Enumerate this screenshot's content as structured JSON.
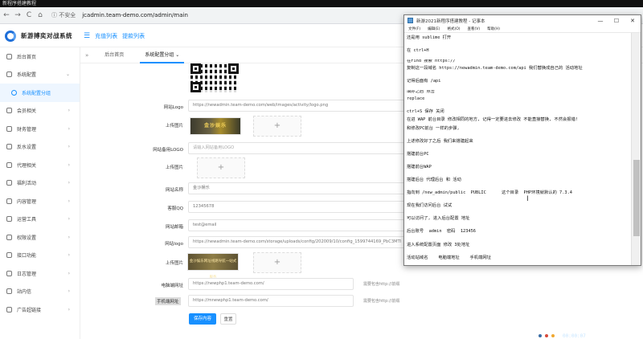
{
  "video": {
    "title": "新程序搭建教程"
  },
  "browser": {
    "back": "←",
    "forward": "→",
    "reload": "C",
    "home": "⌂",
    "insecure": "ⓘ 不安全",
    "url": "jcadmin.team-demo.com/admin/main"
  },
  "app": {
    "name": "新游搏奕对战系统",
    "header_links": [
      "充值列表",
      "提款列表"
    ]
  },
  "sidebar": {
    "items": [
      {
        "label": "后台首页",
        "arrow": ""
      },
      {
        "label": "系统配置",
        "arrow": "⌄"
      },
      {
        "label": "系统配置分组",
        "arrow": "",
        "sub": true
      },
      {
        "label": "会员相关",
        "arrow": "›"
      },
      {
        "label": "财务管理",
        "arrow": "›"
      },
      {
        "label": "反水设置",
        "arrow": "›"
      },
      {
        "label": "代理相关",
        "arrow": "›"
      },
      {
        "label": "福利活动",
        "arrow": "›"
      },
      {
        "label": "内容管理",
        "arrow": "›"
      },
      {
        "label": "运营工具",
        "arrow": "›"
      },
      {
        "label": "权限设置",
        "arrow": "›"
      },
      {
        "label": "接口功能",
        "arrow": "›"
      },
      {
        "label": "日志管理",
        "arrow": "›"
      },
      {
        "label": "站内信",
        "arrow": "›"
      },
      {
        "label": "广告超链接",
        "arrow": "›"
      }
    ]
  },
  "tabs": {
    "toggle": "»",
    "items": [
      "后台首页",
      "系统配置分组"
    ],
    "active_arrow": "⌄"
  },
  "form": {
    "site_logo": {
      "label": "网站Logo",
      "value": "https://newadmin.team-demo.com/web/images/activity/logo.png"
    },
    "upload_image_1": {
      "label": "上传图片",
      "preview_text": "金沙娱乐",
      "plus": "+"
    },
    "mobile_logo": {
      "label": "网站备用LOGO",
      "placeholder": "请输入网站备用LOGO"
    },
    "upload_image_2": {
      "label": "上传图片",
      "plus": "+"
    },
    "site_name": {
      "label": "网站名称",
      "value": "金沙娱乐"
    },
    "support_qq": {
      "label": "客服QQ",
      "value": "12345678"
    },
    "site_email": {
      "label": "网站邮箱",
      "value": "test@email"
    },
    "site_logo_2": {
      "label": "网站logo",
      "value": "https://newadmin.team-demo.com/storage/uploads/config/202009/10/config_1599744169_PbC3MTl"
    },
    "upload_image_3": {
      "label": "上传图片",
      "preview_text": "金沙娱乐网址线路导航一站式服务",
      "plus": "+"
    },
    "pc_url": {
      "label": "电脑端网址",
      "value": "https://newphp1.team-demo.com/",
      "hint": "需要包含http://前缀"
    },
    "mobile_url": {
      "label": "手机端网址",
      "value": "https://mnewphp1.team-demo.com/",
      "hint": "需要包含http://前缀"
    },
    "save_label": "保存内容",
    "reset_label": "重置"
  },
  "notepad": {
    "title": "新游2021新程序搭建教程 - 记事本",
    "controls": [
      "—",
      "☐",
      "✕"
    ],
    "menu": [
      "文件(F)",
      "编辑(E)",
      "格式(O)",
      "查看(V)",
      "帮助(H)"
    ],
    "lines": [
      "还是用 sublime 打开",
      "",
      "在 ctrl+H",
      "",
      "在Find 搜索 https://",
      "复制这一段域名 https://newadmin.team-demo.com/api 我们替换成自己的 活动地址",
      "",
      "记得后面有 /api",
      "",
      "填好之后 点击",
      "replace",
      "",
      "ctrl+S 保存 关闭",
      "在进 WAP 前台目录 修改相同的地方, 记得一定要进去修改 不能直接替换, 不然会报错!",
      "和修改PC前台 一样的步骤,",
      "",
      "上述修改好了之后 我们来搭建起来",
      "",
      "搭建前台PC",
      "",
      "搭建前台WAP",
      "",
      "搭建后台 代理后台 和 活动",
      "",
      "指向到 /new_admin/public  PUBLIC      这个目录  PHP环境就默认的 7.3.4",
      "",
      "现在我们访问后台 试试",
      "",
      "可以访问了, 进入后台配置 地址",
      "",
      "后台账号  admin  密码  123456",
      "",
      "进入系统配置页面 修改 3处地址",
      "",
      "活动站域名    电脑端地址    手机端网址"
    ],
    "cursor": "I"
  },
  "taskbar": {
    "clock": "00:00:07"
  }
}
